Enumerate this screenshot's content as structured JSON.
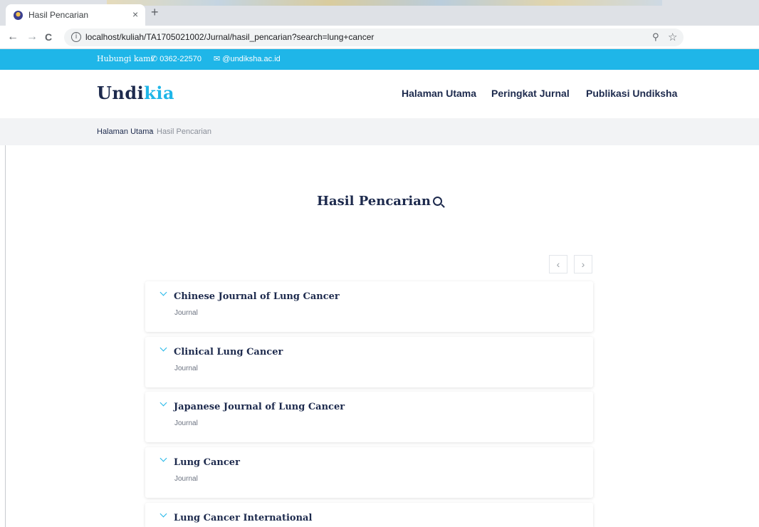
{
  "browser": {
    "tab_title": "Hasil Pencarian",
    "tab_close": "×",
    "new_tab": "+",
    "back": "←",
    "forward": "→",
    "reload": "C",
    "info": "i",
    "url": "localhost/kuliah/TA1705021002/Jurnal/hasil_pencarian?search=lung+cancer",
    "zoom_icon": "zoom-icon",
    "star_icon": "star-icon"
  },
  "topbar": {
    "contact_label": "Hubungi kami",
    "phone": "0362-22570",
    "email": "@undiksha.ac.id",
    "background": "#1fb6e8"
  },
  "header": {
    "logo_main": "Undi",
    "logo_accent": "kia",
    "nav": [
      {
        "label": "Halaman Utama"
      },
      {
        "label": "Peringkat Jurnal"
      },
      {
        "label": "Publikasi Undiksha"
      }
    ]
  },
  "breadcrumb": {
    "home": "Halaman Utama",
    "separator": "›",
    "current": "Hasil Pencarian"
  },
  "main": {
    "title": "Hasil Pencarian",
    "pager_prev": "‹",
    "pager_next": "›",
    "results": [
      {
        "title": "Chinese Journal of Lung Cancer",
        "type": "Journal"
      },
      {
        "title": "Clinical Lung Cancer",
        "type": "Journal"
      },
      {
        "title": "Japanese Journal of Lung Cancer",
        "type": "Journal"
      },
      {
        "title": "Lung Cancer",
        "type": "Journal"
      },
      {
        "title": "Lung Cancer International",
        "type": ""
      }
    ]
  },
  "colors": {
    "accent": "#1fb6e8",
    "navy": "#1d2a4d"
  }
}
